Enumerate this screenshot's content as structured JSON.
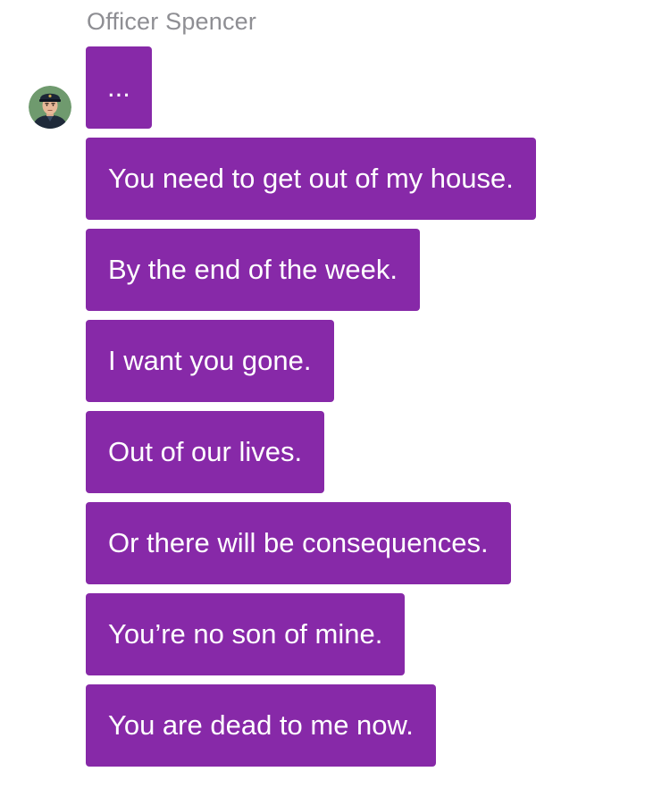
{
  "sender": {
    "name": "Officer Spencer",
    "avatar_icon": "police-officer-avatar"
  },
  "messages": [
    "...",
    "You need to get out of my house.",
    "By the end of the week.",
    "I want you gone.",
    "Out of our lives.",
    "Or there will be consequences.",
    "You’re no son of mine.",
    "You are dead to me now."
  ],
  "colors": {
    "bubble": "#8729a8",
    "bubble_text": "#ffffff",
    "name_text": "#8e8e93",
    "background": "#ffffff"
  }
}
